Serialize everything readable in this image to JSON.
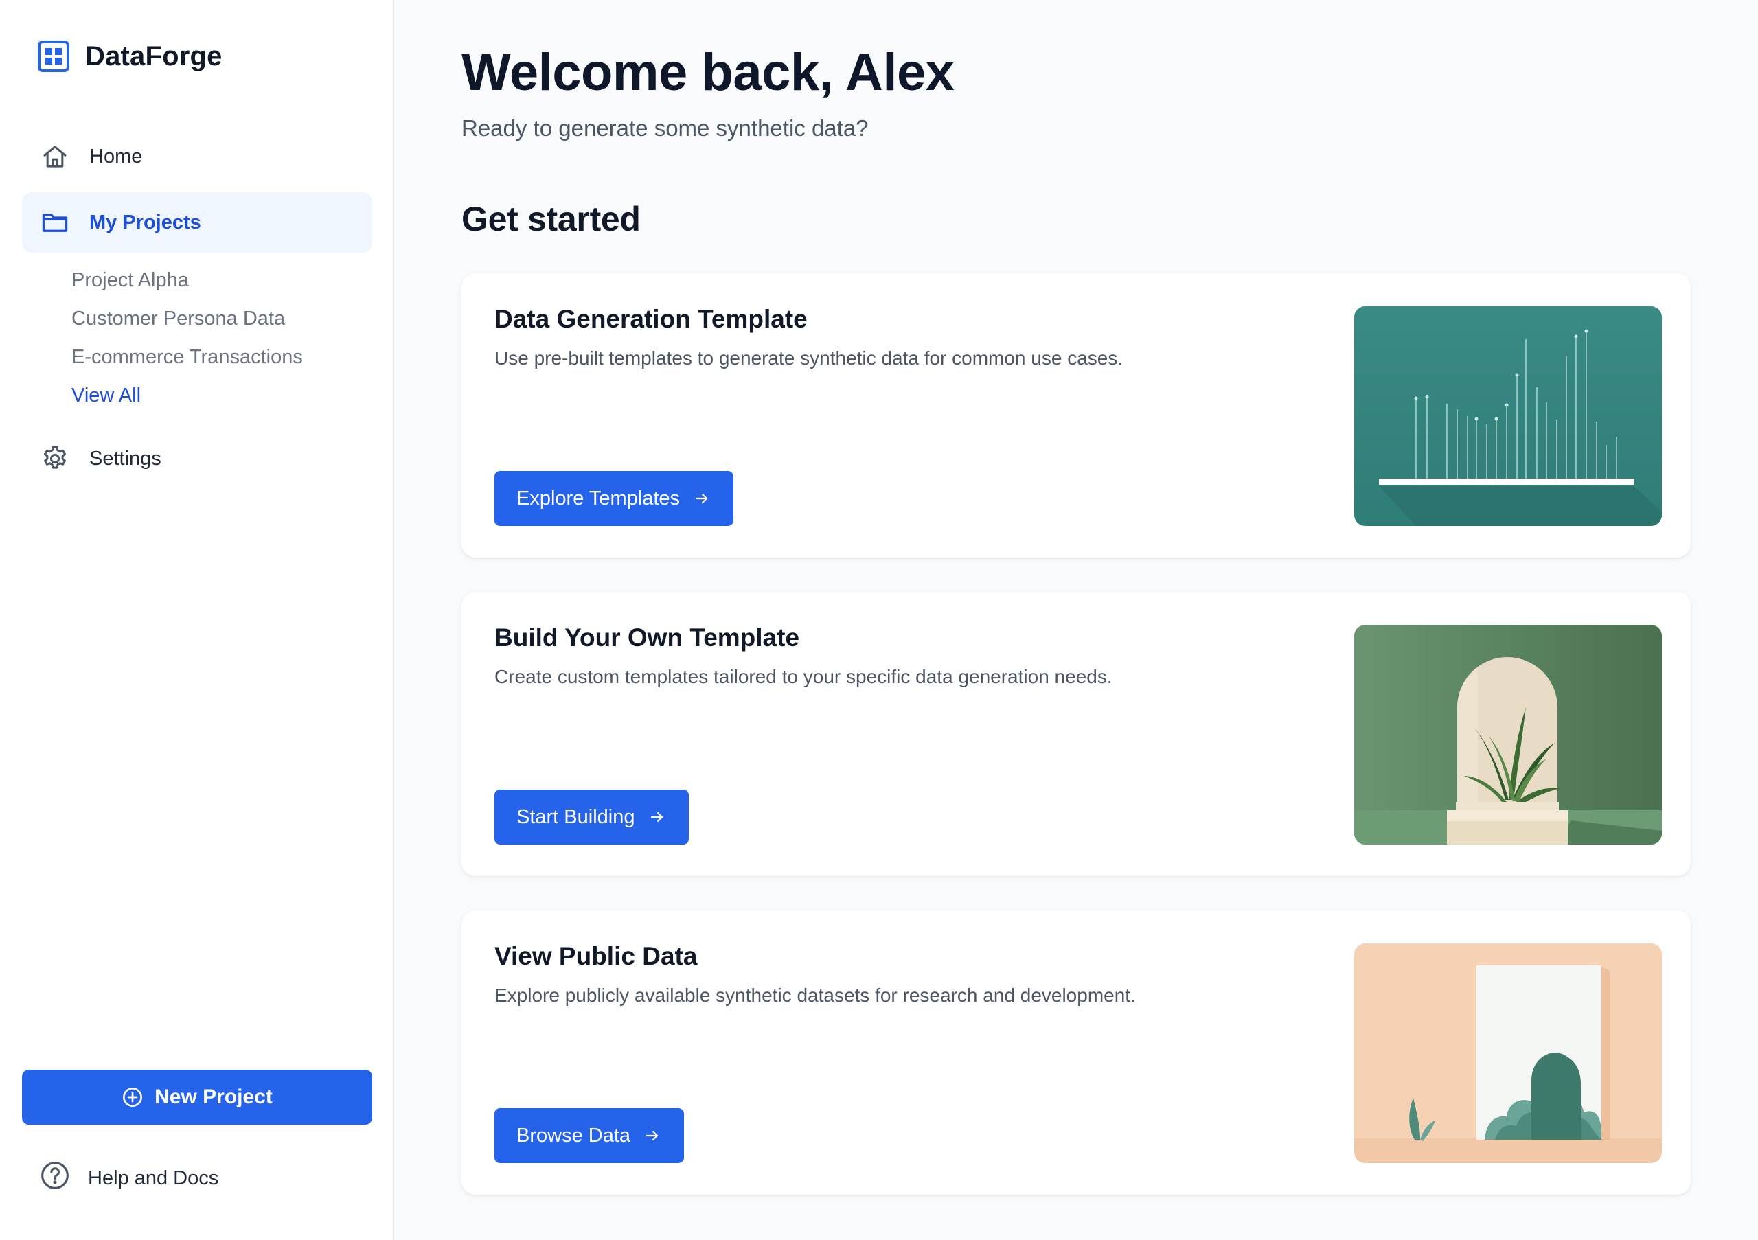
{
  "brand": {
    "name": "DataForge",
    "icon": "grid-icon",
    "accent": "#2563eb"
  },
  "sidebar": {
    "nav": [
      {
        "label": "Home",
        "icon": "home-icon"
      },
      {
        "label": "My Projects",
        "icon": "folder-icon",
        "active": true
      },
      {
        "label": "Settings",
        "icon": "gear-icon"
      }
    ],
    "projects": [
      "Project Alpha",
      "Customer Persona Data",
      "E-commerce Transactions"
    ],
    "view_all": "View All",
    "new_project": "New Project",
    "help": "Help and Docs"
  },
  "main": {
    "welcome": "Welcome back, Alex",
    "subtitle": "Ready to generate some synthetic data?",
    "section_title": "Get started",
    "cards": [
      {
        "title": "Data Generation Template",
        "description": "Use pre-built templates to generate synthetic data for common use cases.",
        "button": "Explore Templates",
        "image": "teal-bar-chart-illustration"
      },
      {
        "title": "Build Your Own Template",
        "description": "Create custom templates tailored to your specific data generation needs.",
        "button": "Start Building",
        "image": "green-arch-plant-illustration"
      },
      {
        "title": "View Public Data",
        "description": "Explore publicly available synthetic datasets for research and development.",
        "button": "Browse Data",
        "image": "peach-landscape-frame-illustration"
      }
    ]
  }
}
